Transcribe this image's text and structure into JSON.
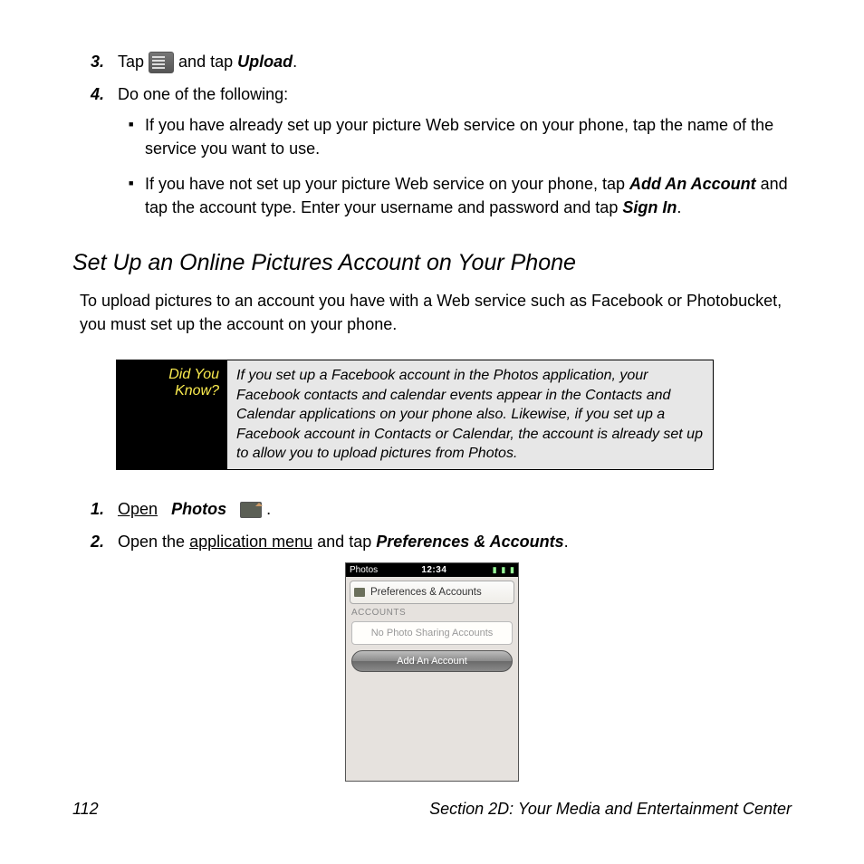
{
  "steps_top": [
    {
      "num": "3.",
      "pre": "Tap ",
      "post": " and tap ",
      "action": "Upload",
      "tail": "."
    },
    {
      "num": "4.",
      "text": "Do one of the following:"
    }
  ],
  "bullets": [
    {
      "text": "If you have already set up your picture Web service on your phone, tap the name of the service you want to use."
    },
    {
      "pre": "If you have not set up your picture Web service on your phone, tap ",
      "b1": "Add An Account",
      "mid": " and tap the account type. Enter your username and password and tap ",
      "b2": "Sign In",
      "tail": "."
    }
  ],
  "heading": "Set Up an Online Pictures Account on Your Phone",
  "intro": "To upload pictures to an account you have with a Web service such as Facebook or Photobucket, you must set up the account on your phone.",
  "tip": {
    "label": "Did You Know?",
    "body": "If you set up a Facebook account in the Photos application, your Facebook contacts and calendar events appear in the Contacts and Calendar applications on your phone also. Likewise, if you set up a Facebook account in Contacts or Calendar, the account is already set up to allow you to upload pictures from Photos."
  },
  "steps_bottom": [
    {
      "num": "1.",
      "link": "Open",
      "app": "Photos",
      "tail": " ."
    },
    {
      "num": "2.",
      "pre": "Open the ",
      "link": "application menu",
      "mid": " and tap ",
      "b": "Preferences & Accounts",
      "tail": "."
    }
  ],
  "phone": {
    "app": "Photos",
    "time": "12:34",
    "menu": "Preferences & Accounts",
    "sectionLabel": "ACCOUNTS",
    "emptyText": "No Photo Sharing Accounts",
    "button": "Add An Account"
  },
  "footer": {
    "page": "112",
    "section": "Section 2D: Your Media and Entertainment Center"
  }
}
